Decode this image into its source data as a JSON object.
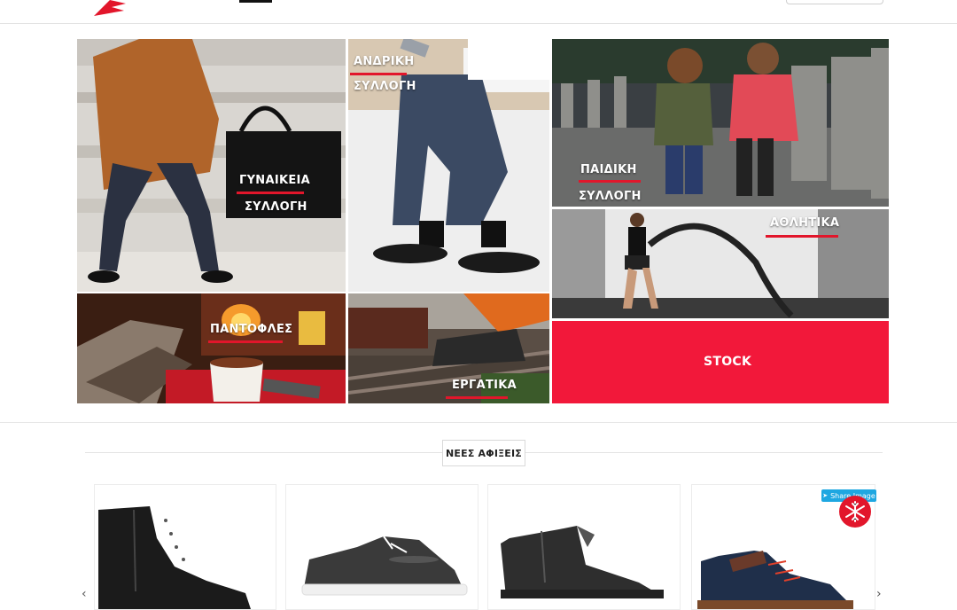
{
  "categories": {
    "women": {
      "line1": "ΓΥΝΑΙΚΕΙΑ",
      "line2": "ΣΥΛΛΟΓΗ"
    },
    "men": {
      "line1": "ΑΝΔΡΙΚΗ",
      "line2": "ΣΥΛΛΟΓΗ"
    },
    "kids": {
      "line1": "ΠΑΙΔΙΚΗ",
      "line2": "ΣΥΛΛΟΓΗ"
    },
    "sports": {
      "label": "ΑΘΛΗΤΙΚΑ"
    },
    "slippers": {
      "label": "ΠΑΝΤΟΦΛΕΣ"
    },
    "work": {
      "label": "ΕΡΓΑΤΙΚΑ"
    },
    "stock": {
      "label": "STOCK"
    }
  },
  "new_arrivals": {
    "title": "ΝΕΕΣ ΑΦΙΞΕΙΣ",
    "share_label": "Share Image",
    "prev_arrow": "‹",
    "next_arrow": "›"
  },
  "colors": {
    "accent": "#e2162b",
    "stock_bg": "#f2183a"
  }
}
